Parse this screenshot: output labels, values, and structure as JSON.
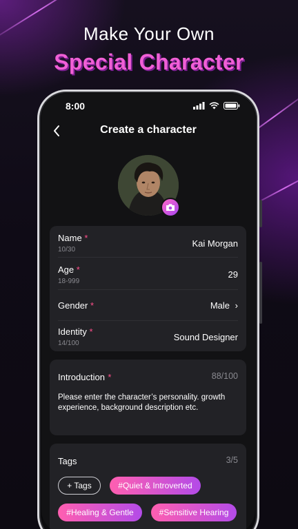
{
  "promo": {
    "line1": "Make Your Own",
    "line2": "Special Character"
  },
  "status_bar": {
    "time": "8:00",
    "icons": [
      "signal-icon",
      "wifi-icon",
      "battery-icon"
    ]
  },
  "header": {
    "back_icon": "chevron-left-icon",
    "title": "Create a character"
  },
  "avatar": {
    "camera_icon": "camera-icon",
    "accent": "#c04fe8"
  },
  "form": {
    "name": {
      "label": "Name",
      "required": "*",
      "count": "10/30",
      "value": "Kai Morgan"
    },
    "age": {
      "label": "Age",
      "required": "*",
      "range": "18-999",
      "value": "29"
    },
    "gender": {
      "label": "Gender",
      "required": "*",
      "value": "Male",
      "chevron": "›"
    },
    "identity": {
      "label": "Identity",
      "required": "*",
      "count": "14/100",
      "value": "Sound Designer"
    }
  },
  "introduction": {
    "label": "Introduction",
    "required": "*",
    "count": "88/100",
    "text": "Please enter the character’s personality. growth experience, background description etc."
  },
  "tags": {
    "label": "Tags",
    "count": "3/5",
    "add_label": "+ Tags",
    "items": [
      "#Quiet & Introverted",
      "#Healing & Gentle",
      "#Sensitive Hearing"
    ]
  },
  "colors": {
    "accent_pink": "#f05fd6",
    "required": "#ff4f8b",
    "card": "#222226",
    "background": "#121214"
  }
}
